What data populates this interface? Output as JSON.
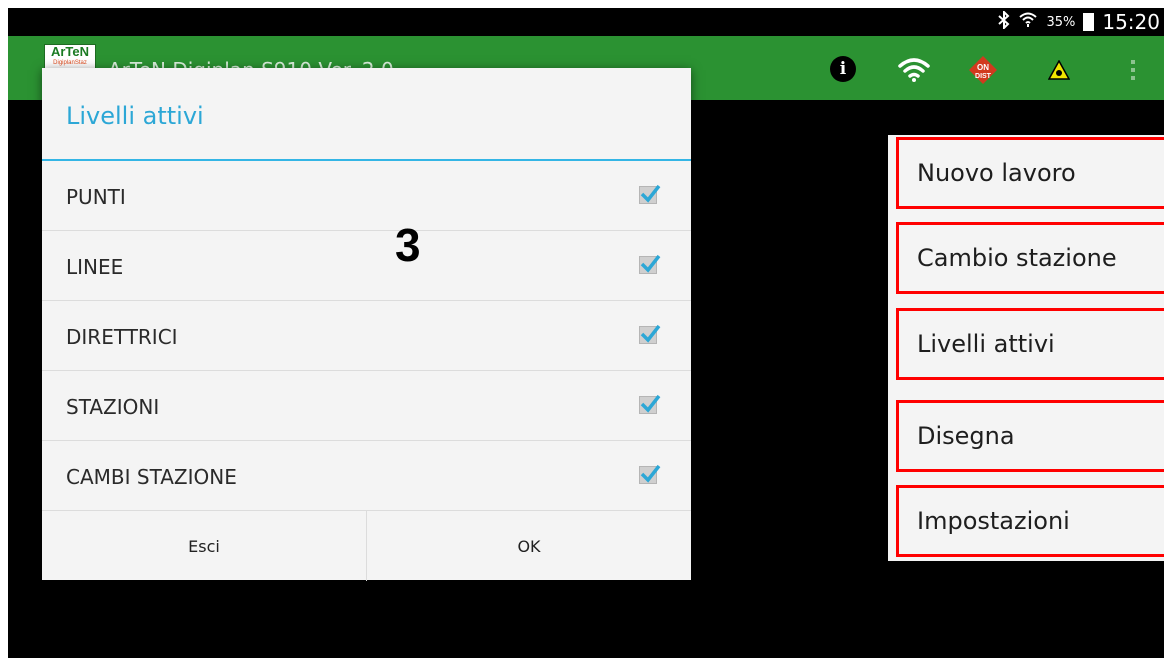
{
  "status_bar": {
    "battery_percent": "35%",
    "time": "15:20",
    "icons": [
      "bluetooth-icon",
      "wifi-signal-icon",
      "battery-icon"
    ]
  },
  "action_bar": {
    "logo_text": "ArTeN",
    "logo_subtext": "DigiplanStaz",
    "app_title": "ArTeN Digiplan S910 Ver. 2.0",
    "icons": [
      "info-icon",
      "wifi-icon",
      "on-dist-icon",
      "laser-warning-icon",
      "overflow-menu-icon"
    ],
    "on_dist_text": [
      "ON",
      "DIST"
    ]
  },
  "dialog": {
    "title": "Livelli attivi",
    "items": [
      {
        "label": "PUNTI",
        "checked": true
      },
      {
        "label": "LINEE",
        "checked": true
      },
      {
        "label": "DIRETTRICI",
        "checked": true
      },
      {
        "label": "STAZIONI",
        "checked": true
      },
      {
        "label": "CAMBI STAZIONE",
        "checked": true
      }
    ],
    "buttons": {
      "cancel": "Esci",
      "ok": "OK"
    }
  },
  "annotation": {
    "step_number": "3"
  },
  "menu": {
    "items": [
      {
        "label": "Nuovo lavoro"
      },
      {
        "label": "Cambio stazione"
      },
      {
        "label": "Livelli attivi"
      },
      {
        "label": "Disegna"
      },
      {
        "label": "Impostazioni"
      }
    ]
  },
  "colors": {
    "action_bar": "#2b9232",
    "accent": "#33b5e5",
    "highlight": "#ff0000",
    "checkbox_tick": "#2ca7d6"
  }
}
